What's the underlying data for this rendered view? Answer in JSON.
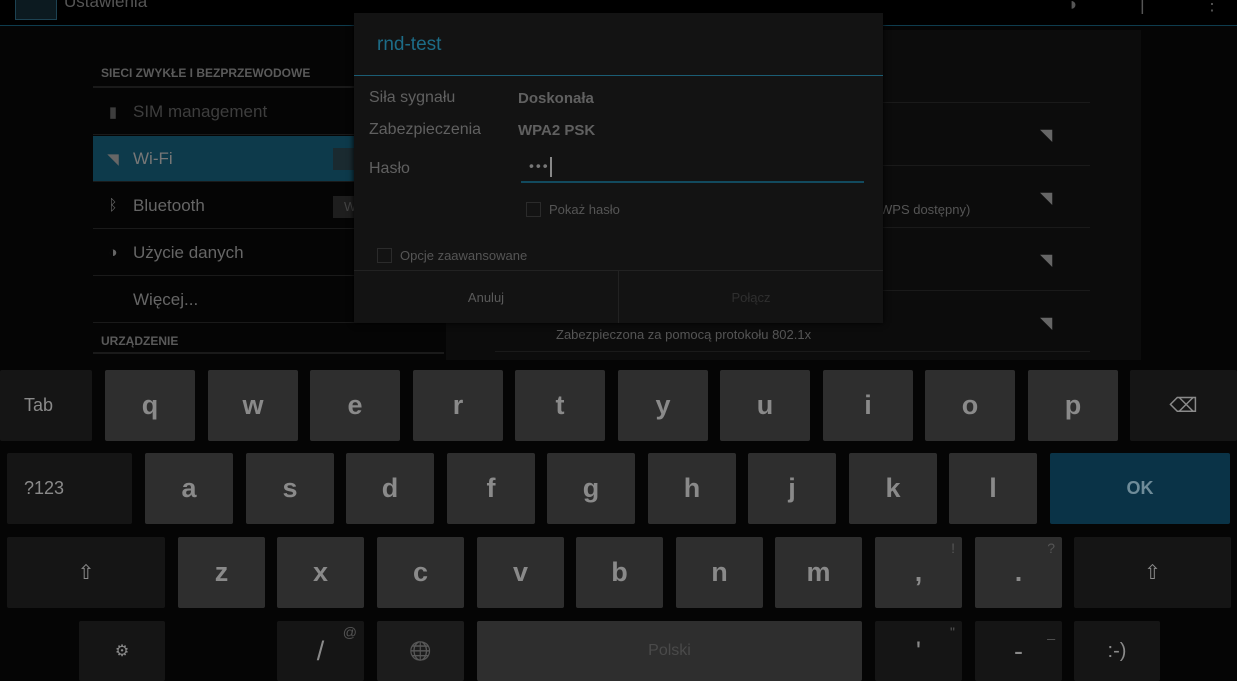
{
  "app": {
    "title": "Ustawienia"
  },
  "settings": {
    "section_wireless": "SIECI ZWYKŁE I BEZPRZEWODOWE",
    "items": [
      {
        "label": "SIM management",
        "icon": "sim-icon"
      },
      {
        "label": "Wi-Fi",
        "icon": "wifi-icon"
      },
      {
        "label": "Bluetooth",
        "icon": "bluetooth-icon"
      },
      {
        "label": "Użycie danych",
        "icon": "data-usage-icon"
      },
      {
        "label": "Więcej...",
        "icon": ""
      }
    ],
    "section_device": "URZĄDZENIE",
    "bluetooth_toggle_fragment": "W"
  },
  "networks": [
    {
      "summary": ""
    },
    {
      "summary": "WPS dostępny)"
    },
    {
      "summary": ""
    },
    {
      "summary": "Zabezpieczona za pomocą protokołu 802.1x"
    }
  ],
  "dialog": {
    "title": "rnd-test",
    "signal_label": "Siła sygnału",
    "signal_value": "Doskonała",
    "security_label": "Zabezpieczenia",
    "security_value": "WPA2 PSK",
    "password_label": "Hasło",
    "password_value": "•••",
    "show_password": "Pokaż hasło",
    "advanced": "Opcje zaawansowane",
    "cancel": "Anuluj",
    "connect": "Połącz"
  },
  "keyboard": {
    "row1": [
      "q",
      "w",
      "e",
      "r",
      "t",
      "y",
      "u",
      "i",
      "o",
      "p"
    ],
    "row2": [
      "a",
      "s",
      "d",
      "f",
      "g",
      "h",
      "j",
      "k",
      "l"
    ],
    "row3": [
      "z",
      "x",
      "c",
      "v",
      "b",
      "n",
      "m",
      ",",
      "."
    ],
    "row3_hints": [
      "",
      "",
      "",
      "",
      "",
      "",
      "",
      "!",
      "?"
    ],
    "tab": "Tab",
    "sym": "?123",
    "ok": "OK",
    "space": "Polski",
    "slash": "/",
    "slash_hint": "@",
    "apos": "'",
    "apos_hint": "\"",
    "dash": "-",
    "dash_hint": "_",
    "smiley": ":-)",
    "backspace_icon": "⌫",
    "shift_icon": "⇧",
    "settings_icon": "⚙",
    "globe_icon": "🌐",
    "ok_color": "#0a3347"
  }
}
